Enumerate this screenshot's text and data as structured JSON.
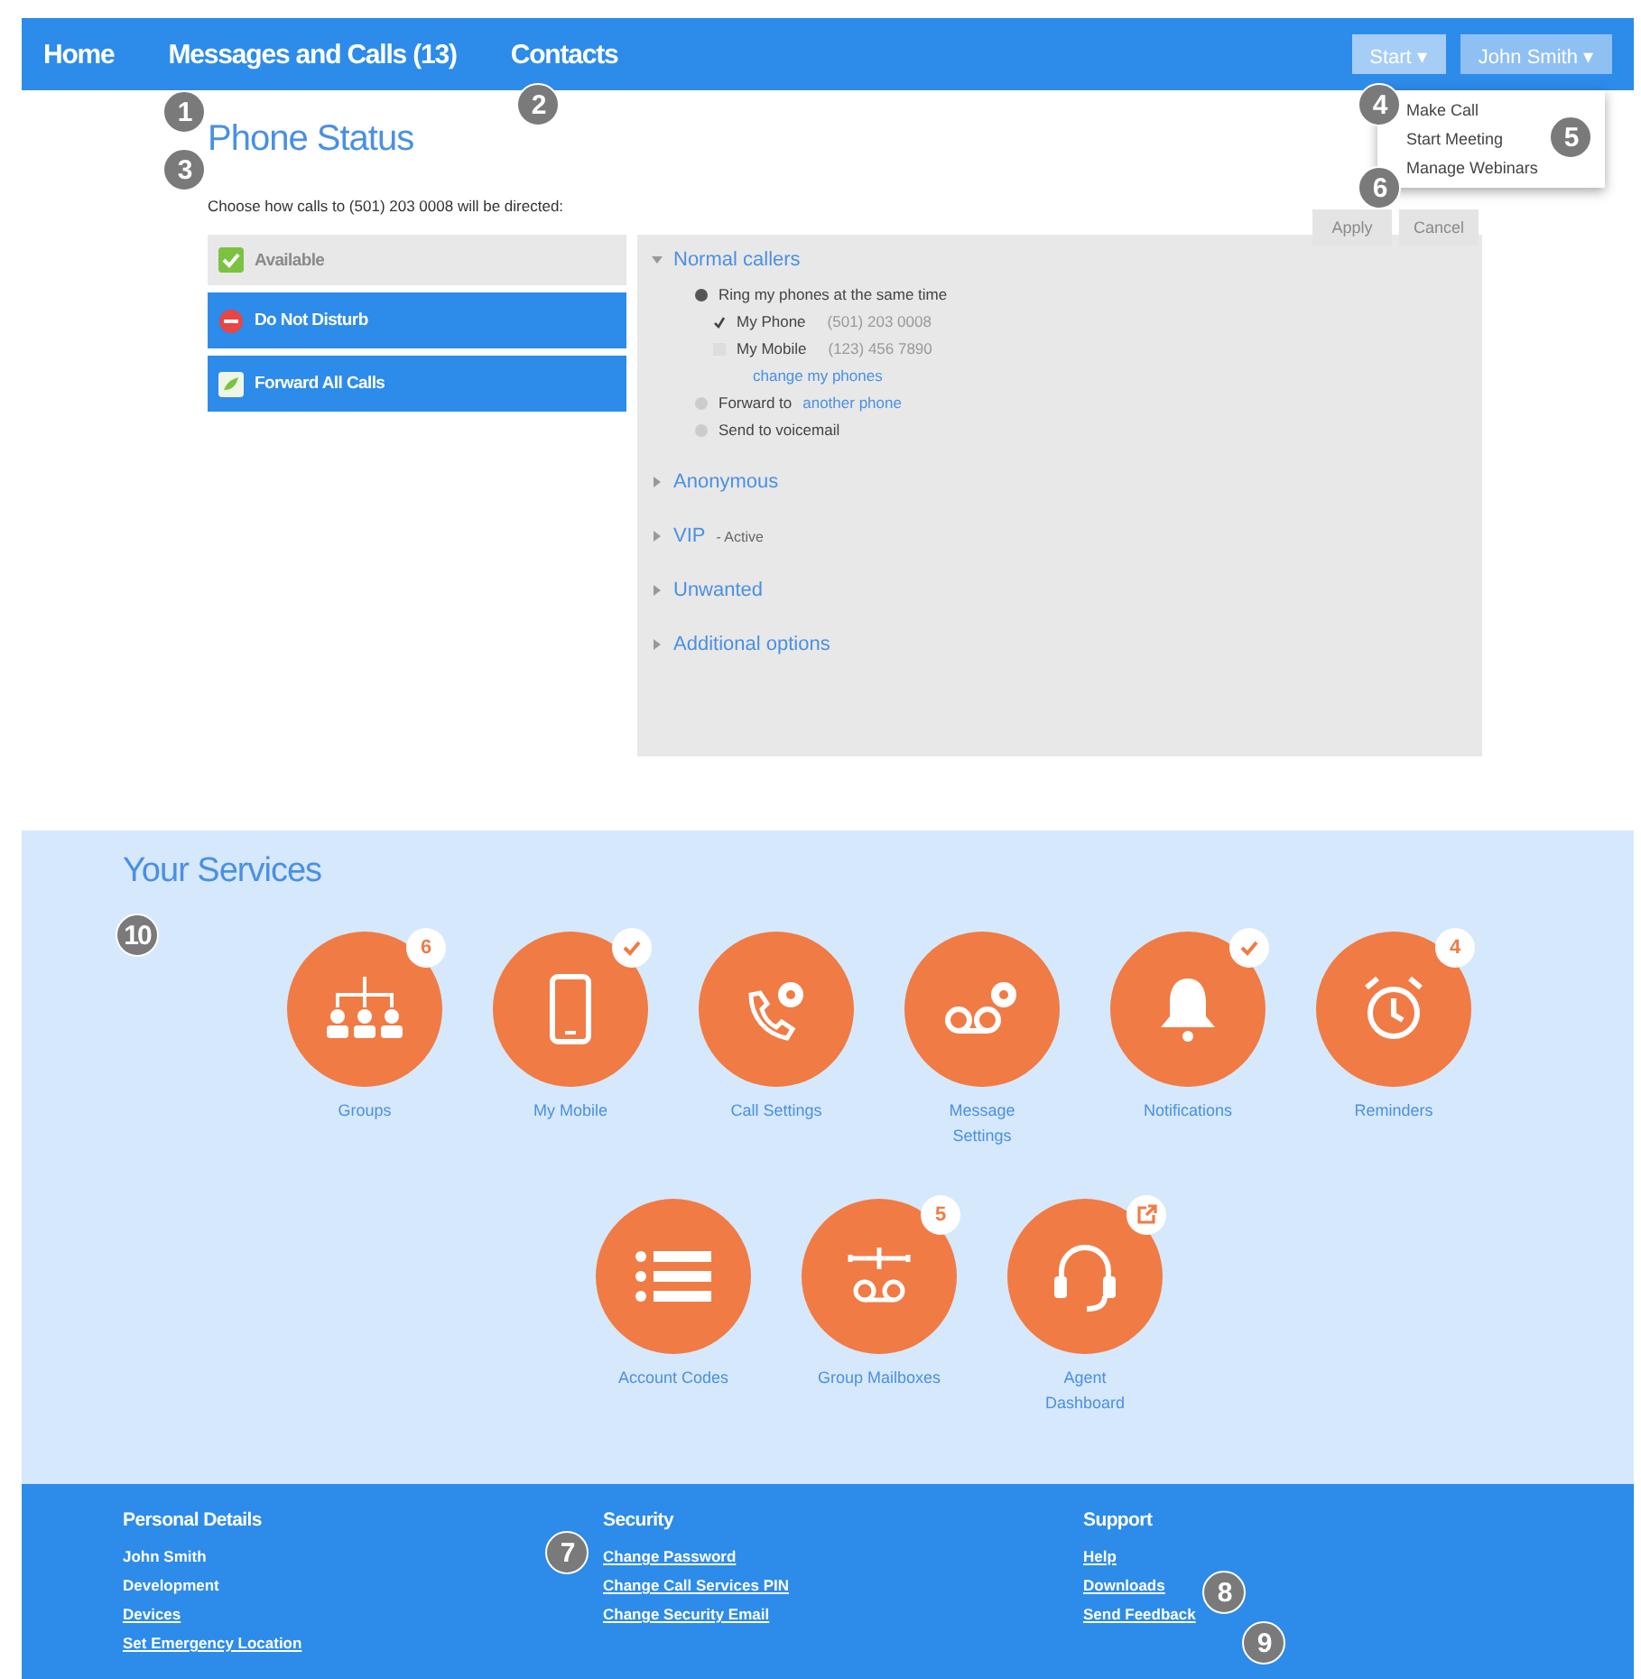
{
  "top_nav": {
    "links": [
      {
        "label": "Home",
        "selected": false
      },
      {
        "label": "Messages and Calls (13)",
        "selected": false
      },
      {
        "label": "Contacts",
        "selected": false
      }
    ],
    "buttons": [
      {
        "label": "Start",
        "caret": "▾",
        "expanded": true
      },
      {
        "label": "John Smith",
        "caret": "▾",
        "expanded": false
      }
    ],
    "start_menu": [
      "Make Call",
      "Start Meeting",
      "Manage Webinars"
    ]
  },
  "phone_status": {
    "title": "Phone Status",
    "instruction": "Choose how calls to (501) 203 0008 will be directed:",
    "buttons": [
      {
        "label": "Apply",
        "disabled": true
      },
      {
        "label": "Cancel",
        "disabled": true
      }
    ],
    "statuses": [
      {
        "label": "Available",
        "selected": true
      },
      {
        "label": "Do Not Disturb",
        "selected": false
      },
      {
        "label": "Forward All Calls",
        "selected": false
      }
    ],
    "sections": [
      {
        "title": "Normal callers",
        "expanded": true
      },
      {
        "title": "Anonymous",
        "expanded": false
      },
      {
        "title": "VIP",
        "note": "- Active",
        "expanded": false
      },
      {
        "title": "Unwanted",
        "expanded": false
      },
      {
        "title": "Additional options",
        "expanded": false
      }
    ],
    "normal_callers": {
      "options": [
        {
          "label": "Ring my phones at the same time",
          "selected": true
        },
        {
          "label": "Forward to",
          "link": "another phone",
          "selected": false
        },
        {
          "label": "Send to voicemail",
          "selected": false
        }
      ],
      "phones": [
        {
          "label": "My Phone",
          "number": "(501) 203 0008",
          "checked": true
        },
        {
          "label": "My Mobile",
          "number": "(123) 456 7890",
          "checked": false
        }
      ],
      "change_link": "change my phones"
    }
  },
  "services": {
    "title": "Your Services",
    "items": [
      {
        "label": "Groups",
        "badge": {
          "kind": "count",
          "text": "6"
        }
      },
      {
        "label": "My Mobile",
        "badge": {
          "kind": "check"
        }
      },
      {
        "label": "Call Settings"
      },
      {
        "label": "Message Settings"
      },
      {
        "label": "Notifications",
        "badge": {
          "kind": "check"
        }
      },
      {
        "label": "Reminders",
        "badge": {
          "kind": "count",
          "text": "4"
        }
      },
      {
        "label": "Account Codes"
      },
      {
        "label": "Group Mailboxes",
        "badge": {
          "kind": "count",
          "text": "5"
        }
      },
      {
        "label": "Agent Dashboard",
        "badge": {
          "kind": "external"
        }
      }
    ]
  },
  "footer": {
    "columns": [
      {
        "heading": "Personal Details",
        "links": [
          {
            "label": "John Smith",
            "underlined": false
          },
          {
            "label": "Development",
            "underlined": false
          },
          {
            "label": "Devices",
            "underlined": true
          },
          {
            "label": "Set Emergency Location",
            "underlined": true
          }
        ]
      },
      {
        "heading": "Security",
        "links": [
          {
            "label": "Change Password",
            "underlined": true
          },
          {
            "label": "Change Call Services PIN",
            "underlined": true
          },
          {
            "label": "Change Security Email",
            "underlined": true
          }
        ]
      },
      {
        "heading": "Support",
        "links": [
          {
            "label": "Help",
            "underlined": true
          },
          {
            "label": "Downloads",
            "underlined": true
          },
          {
            "label": "Send Feedback",
            "underlined": true
          }
        ]
      }
    ]
  },
  "callouts": [
    "1",
    "2",
    "3",
    "4",
    "5",
    "6",
    "7",
    "8",
    "9",
    "10"
  ]
}
